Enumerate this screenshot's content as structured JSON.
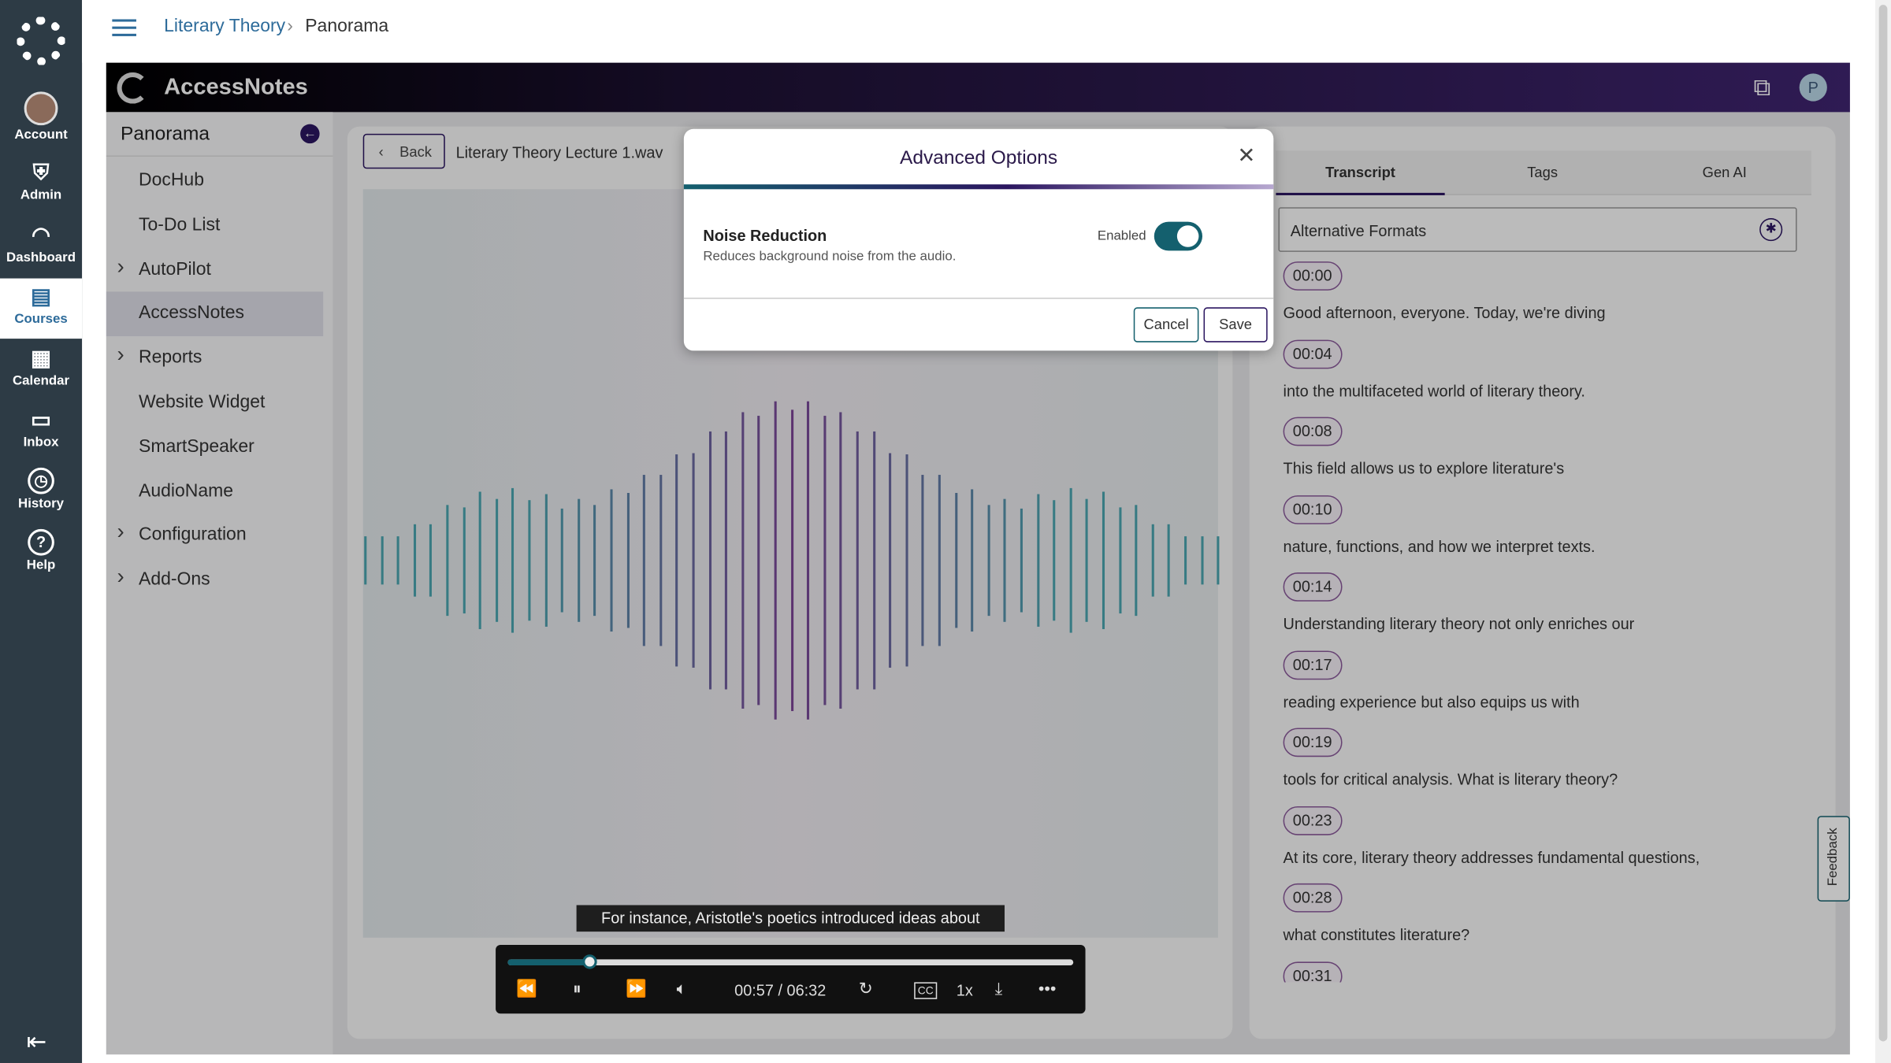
{
  "nav": {
    "items": [
      {
        "label": "Account",
        "icon": "avatar"
      },
      {
        "label": "Admin",
        "icon": "shield-icon"
      },
      {
        "label": "Dashboard",
        "icon": "speedometer-icon"
      },
      {
        "label": "Courses",
        "icon": "book-icon",
        "active": true
      },
      {
        "label": "Calendar",
        "icon": "calendar-icon"
      },
      {
        "label": "Inbox",
        "icon": "inbox-icon"
      },
      {
        "label": "History",
        "icon": "clock-icon"
      },
      {
        "label": "Help",
        "icon": "help-icon"
      }
    ]
  },
  "breadcrumb": {
    "parent": "Literary Theory",
    "sep": "›",
    "current": "Panorama"
  },
  "app": {
    "title": "AccessNotes",
    "avatar_letter": "P",
    "header_gradient": [
      "#000000",
      "#3f2470"
    ]
  },
  "leftpanel": {
    "title": "Panorama",
    "items": [
      {
        "label": "DocHub",
        "expandable": false
      },
      {
        "label": "To-Do List",
        "expandable": false
      },
      {
        "label": "AutoPilot",
        "expandable": true
      },
      {
        "label": "AccessNotes",
        "expandable": false,
        "active": true
      },
      {
        "label": "Reports",
        "expandable": true
      },
      {
        "label": "Website Widget",
        "expandable": false
      },
      {
        "label": "SmartSpeaker",
        "expandable": false
      },
      {
        "label": "AudioName",
        "expandable": false
      },
      {
        "label": "Configuration",
        "expandable": true
      },
      {
        "label": "Add-Ons",
        "expandable": true
      }
    ]
  },
  "media": {
    "back_label": "Back",
    "file_name": "Literary Theory Lecture 1.wav",
    "caption": "For instance, Aristotle's poetics introduced ideas about",
    "time": "00:57 / 06:32",
    "progress": 0.146,
    "speed": "1x"
  },
  "tabs": [
    {
      "label": "Transcript",
      "active": true
    },
    {
      "label": "Tags"
    },
    {
      "label": "Gen AI"
    }
  ],
  "alt_formats": "Alternative Formats",
  "transcript": [
    {
      "time": "00:00",
      "text": "Good afternoon, everyone. Today, we're diving"
    },
    {
      "time": "00:04",
      "text": "into the multifaceted world of literary theory."
    },
    {
      "time": "00:08",
      "text": "This field allows us to explore literature's"
    },
    {
      "time": "00:10",
      "text": "nature, functions, and how we interpret texts."
    },
    {
      "time": "00:14",
      "text": "Understanding literary theory not only enriches our"
    },
    {
      "time": "00:17",
      "text": "reading experience but also equips us with"
    },
    {
      "time": "00:19",
      "text": "tools for critical analysis. What is literary theory?"
    },
    {
      "time": "00:23",
      "text": "At its core, literary theory addresses fundamental questions,"
    },
    {
      "time": "00:28",
      "text": "what constitutes literature?"
    },
    {
      "time": "00:31",
      "text": ""
    }
  ],
  "feedback": "Feedback",
  "modal": {
    "title": "Advanced Options",
    "setting_title": "Noise Reduction",
    "setting_desc": "Reduces background noise from the audio.",
    "toggle_label": "Enabled",
    "toggle_on": true,
    "cancel": "Cancel",
    "save": "Save"
  },
  "colors": {
    "teal": "#14606e",
    "purple": "#3d2169",
    "nav": "#2d3b45"
  }
}
